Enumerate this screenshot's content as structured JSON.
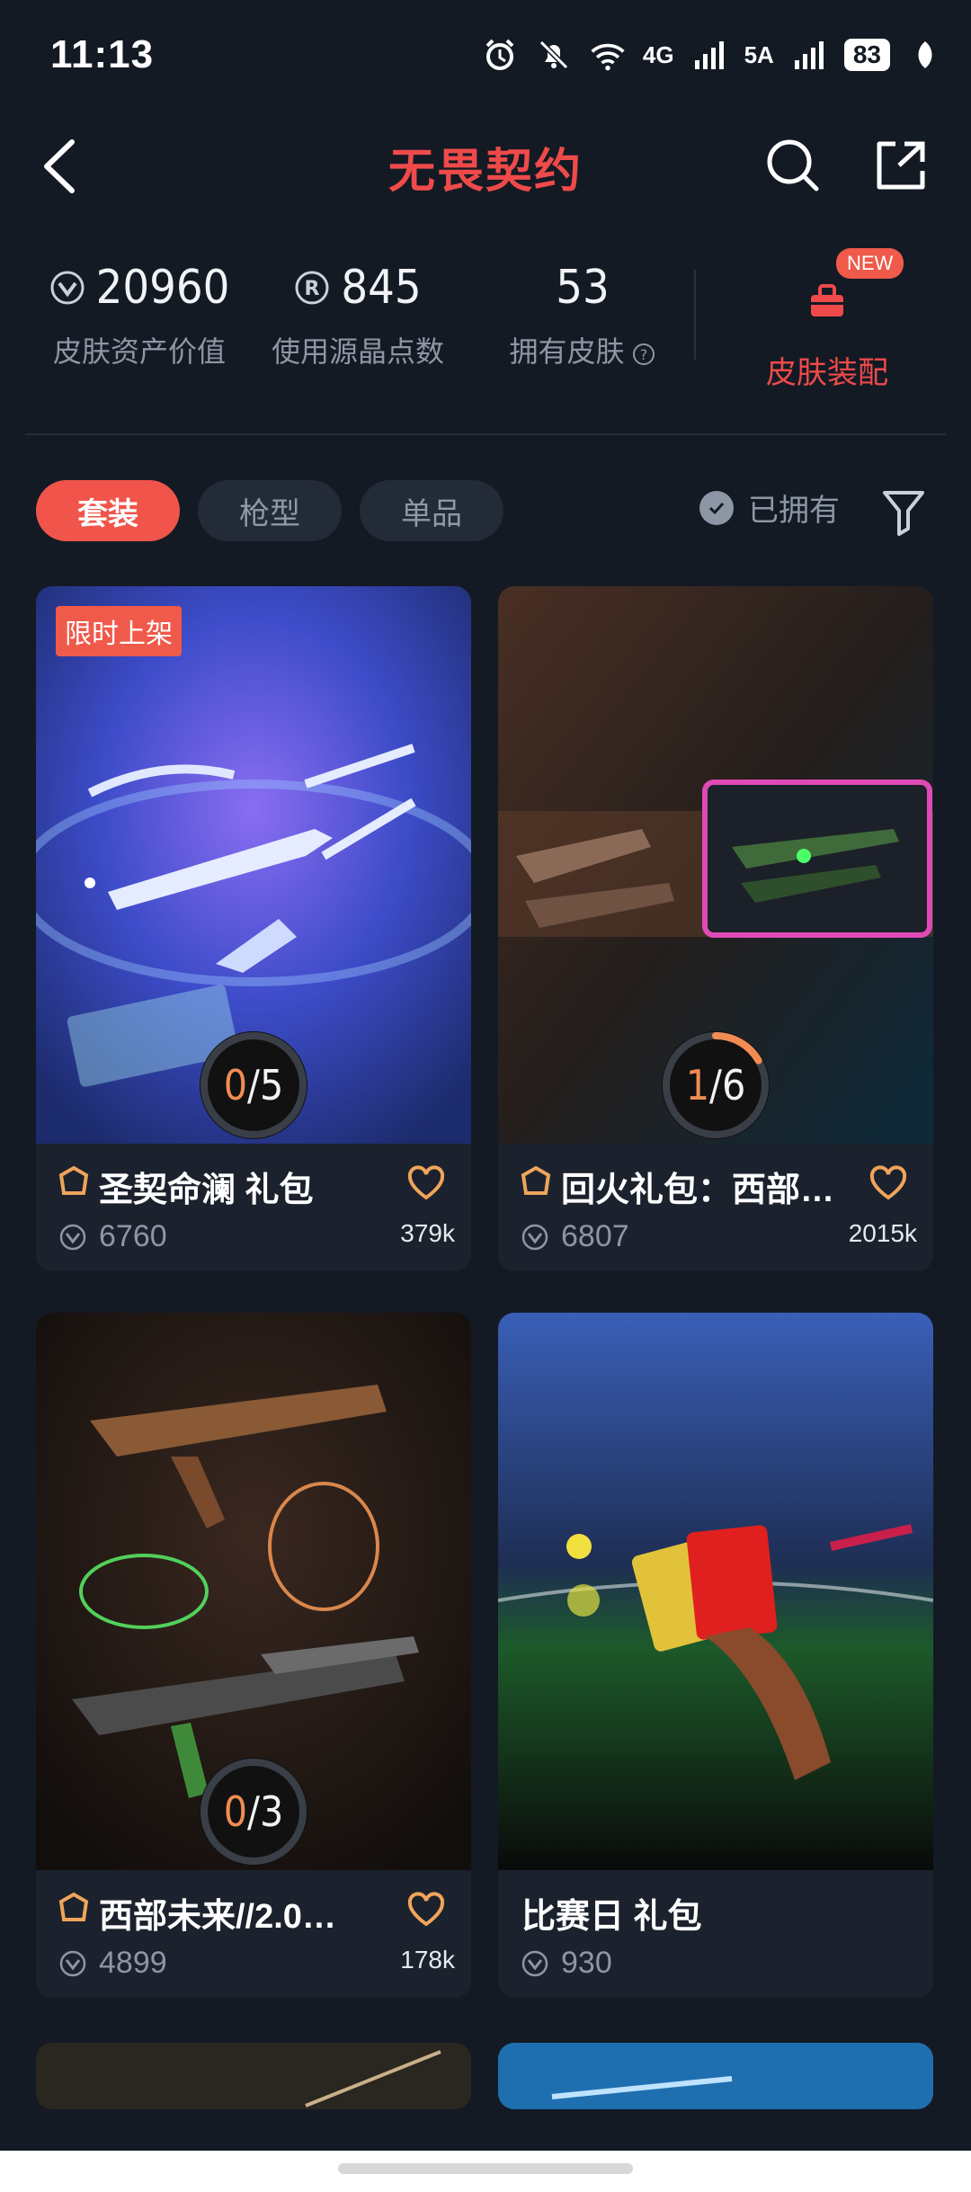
{
  "status_bar": {
    "time": "11:13",
    "signal1": "4G",
    "signal2": "5A",
    "battery": "83",
    "wifi_label": "6"
  },
  "header": {
    "title": "无畏契约"
  },
  "stats": [
    {
      "value": "20960",
      "label": "皮肤资产价值",
      "icon": "vp-icon"
    },
    {
      "value": "845",
      "label": "使用源晶点数",
      "icon": "radianite-icon"
    },
    {
      "value": "53",
      "label": "拥有皮肤",
      "icon": "help-icon"
    }
  ],
  "equip": {
    "label": "皮肤装配",
    "badge": "NEW"
  },
  "tabs": [
    {
      "label": "套装",
      "active": true
    },
    {
      "label": "枪型",
      "active": false
    },
    {
      "label": "单品",
      "active": false
    }
  ],
  "filter": {
    "owned_label": "已拥有"
  },
  "cards": [
    {
      "title": "圣契命澜 礼包",
      "price": "6760",
      "count": "379k",
      "owned": "0",
      "total": "/5",
      "badge": "限时上架",
      "progress": 0
    },
    {
      "title": "回火礼包：西部…",
      "price": "6807",
      "count": "2015k",
      "owned": "1",
      "total": "/6",
      "progress": 0.1667
    },
    {
      "title": "西部未来//2.0…",
      "price": "4899",
      "count": "178k",
      "owned": "0",
      "total": "/3",
      "progress": 0
    },
    {
      "title": "比赛日 礼包",
      "price": "930"
    }
  ],
  "colors": {
    "accent": "#ef4a4a",
    "background": "#131a24",
    "card": "#1b222d",
    "progress": "#f08c52"
  }
}
